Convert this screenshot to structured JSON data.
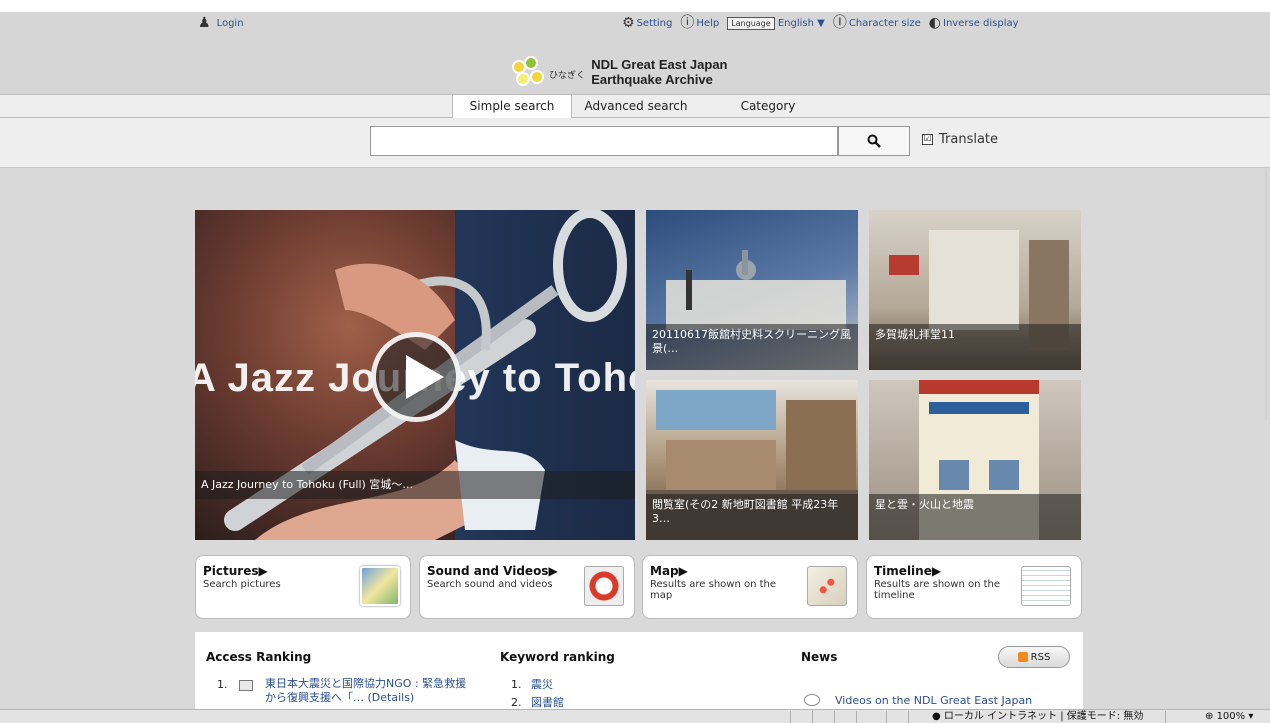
{
  "util": {
    "login": "Login",
    "setting": "Setting",
    "help": "Help",
    "language_box": "Language",
    "language": "English ▼",
    "character_size": "Character size",
    "inverse_display": "Inverse display"
  },
  "brand": {
    "hinagiku": "ひなぎく",
    "title_line1": "NDL Great East Japan",
    "title_line2": "Earthquake Archive"
  },
  "tabs": {
    "simple": "Simple search",
    "advanced": "Advanced search",
    "category": "Category"
  },
  "search": {
    "value": "",
    "translate_label": "Translate",
    "translate_checked": "☑"
  },
  "featured": {
    "hero_overlay": "A Jazz Journey to Tohoku",
    "hero_caption": "A Jazz Journey to Tohoku (Full) 宮城〜…",
    "thumb1": "20110617飯舘村史料スクリーニング風景(…",
    "thumb2": "多賀城礼拝堂11",
    "thumb3": "閲覧室(その2 新地町図書館 平成23年3…",
    "thumb4": "星と雲・火山と地震"
  },
  "categories": [
    {
      "title": "Pictures▶",
      "desc": "Search pictures"
    },
    {
      "title": "Sound and Videos▶",
      "desc": "Search sound and videos"
    },
    {
      "title": "Map▶",
      "desc": "Results are shown on the map"
    },
    {
      "title": "Timeline▶",
      "desc": "Results are shown on the timeline"
    }
  ],
  "panel": {
    "access_ranking": "Access Ranking",
    "access_item1_num": "1.",
    "access_item1": "東日本大震災と国際協力NGO : 緊急救援から復興支援へ「… (Details)",
    "keyword_ranking": "Keyword ranking",
    "kw1_num": "1.",
    "kw1": "震災",
    "kw2_num": "2.",
    "kw2": "図書館",
    "news": "News",
    "rss": "RSS",
    "news_item1": "Videos on the NDL Great East Japan"
  },
  "status": {
    "zone": "ローカル イントラネット | 保護モード: 無効",
    "zoom": "100%"
  }
}
